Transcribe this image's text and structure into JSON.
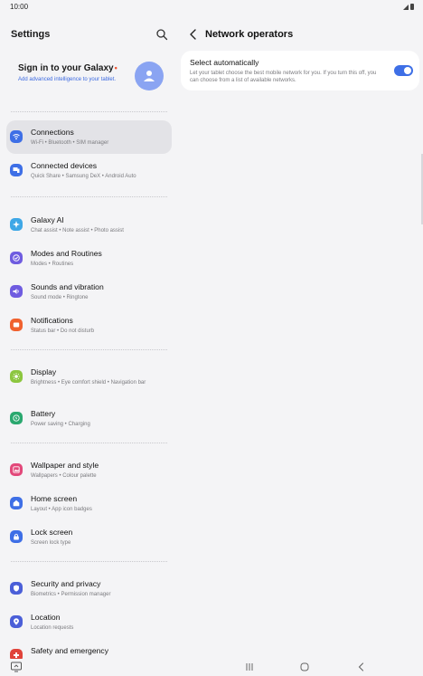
{
  "status_bar": {
    "time": "10:00"
  },
  "left": {
    "title": "Settings",
    "account": {
      "title": "Sign in to your Galaxy",
      "subtitle": "Add advanced intelligence to your tablet."
    },
    "items": [
      {
        "label": "Connections",
        "sub": "Wi-Fi  •  Bluetooth  •  SIM manager",
        "color": "#3e6fe6",
        "icon": "wifi-icon"
      },
      {
        "label": "Connected devices",
        "sub": "Quick Share  •  Samsung DeX  •  Android Auto",
        "color": "#3e6fe6",
        "icon": "devices-icon"
      },
      {
        "label": "Galaxy AI",
        "sub": "Chat assist  •  Note assist  •  Photo assist",
        "color": "#3ea7e6",
        "icon": "sparkle-icon"
      },
      {
        "label": "Modes and Routines",
        "sub": "Modes  •  Routines",
        "color": "#6f5ce0",
        "icon": "check-circle-icon"
      },
      {
        "label": "Sounds and vibration",
        "sub": "Sound mode  •  Ringtone",
        "color": "#6f5ce0",
        "icon": "volume-icon"
      },
      {
        "label": "Notifications",
        "sub": "Status bar  •  Do not disturb",
        "color": "#f0612e",
        "icon": "bell-icon"
      },
      {
        "label": "Display",
        "sub": "Brightness  •  Eye comfort shield  •  Navigation bar",
        "color": "#8cc63f",
        "icon": "sun-icon"
      },
      {
        "label": "Battery",
        "sub": "Power saving  •  Charging",
        "color": "#2aa86f",
        "icon": "battery-icon"
      },
      {
        "label": "Wallpaper and style",
        "sub": "Wallpapers  •  Colour palette",
        "color": "#e2487a",
        "icon": "wallpaper-icon"
      },
      {
        "label": "Home screen",
        "sub": "Layout  •  App icon badges",
        "color": "#3e6fe6",
        "icon": "home-icon"
      },
      {
        "label": "Lock screen",
        "sub": "Screen lock type",
        "color": "#3e6fe6",
        "icon": "lock-icon"
      },
      {
        "label": "Security and privacy",
        "sub": "Biometrics  •  Permission manager",
        "color": "#4b5fd8",
        "icon": "shield-icon"
      },
      {
        "label": "Location",
        "sub": "Location requests",
        "color": "#4b5fd8",
        "icon": "location-icon"
      },
      {
        "label": "Safety and emergency",
        "sub": "",
        "color": "#e0433a",
        "icon": "emergency-icon"
      }
    ]
  },
  "right": {
    "title": "Network operators",
    "setting": {
      "label": "Select automatically",
      "description": "Let your tablet choose the best mobile network for you. If you turn this off, you can choose from a list of available networks.",
      "enabled": true
    }
  }
}
